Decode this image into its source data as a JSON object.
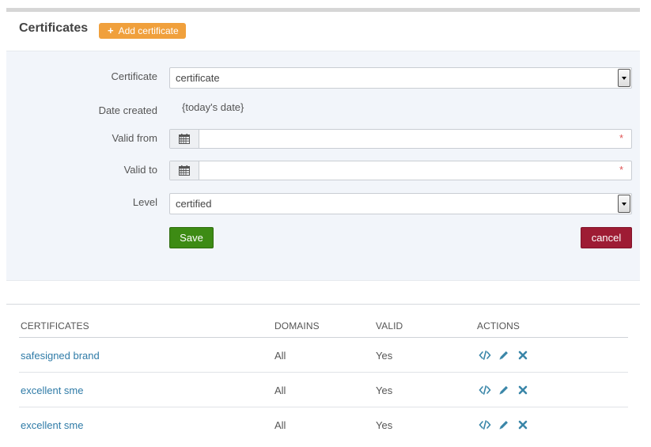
{
  "header": {
    "title": "Certificates",
    "add_button_label": "Add certificate"
  },
  "form": {
    "certificate": {
      "label": "Certificate",
      "value": "certificate"
    },
    "date_created": {
      "label": "Date created",
      "value": "{today's date}"
    },
    "valid_from": {
      "label": "Valid from",
      "value": "",
      "required_mark": "*"
    },
    "valid_to": {
      "label": "Valid to",
      "value": "",
      "required_mark": "*"
    },
    "level": {
      "label": "Level",
      "value": "certified"
    },
    "save_label": "Save",
    "cancel_label": "cancel"
  },
  "table": {
    "columns": [
      "CERTIFICATES",
      "DOMAINS",
      "VALID",
      "ACTIONS"
    ],
    "rows": [
      {
        "name": "safesigned brand",
        "domains": "All",
        "valid": "Yes"
      },
      {
        "name": "excellent sme",
        "domains": "All",
        "valid": "Yes"
      },
      {
        "name": "excellent sme",
        "domains": "All",
        "valid": "Yes"
      }
    ],
    "action_icons": [
      "code-icon",
      "pencil-icon",
      "close-icon"
    ]
  },
  "colors": {
    "accent_orange": "#f0a03c",
    "save_green": "#3d8b14",
    "cancel_red": "#9e1c34",
    "link_blue": "#2f7ba7",
    "icon_teal": "#3a86a8"
  }
}
